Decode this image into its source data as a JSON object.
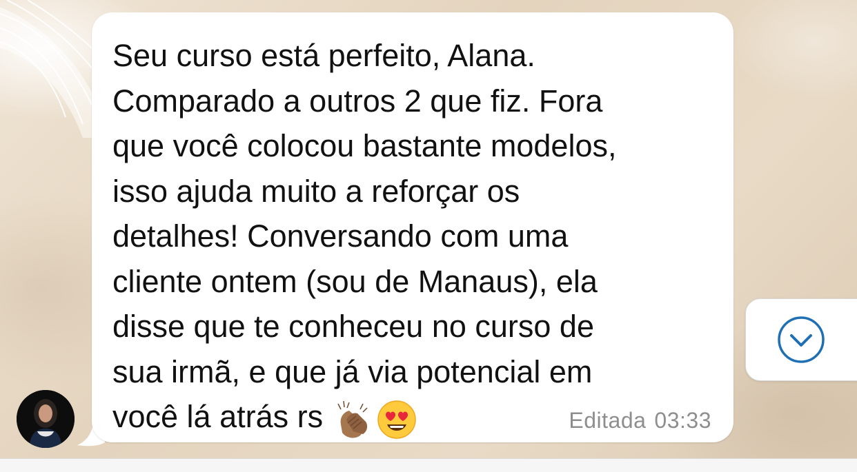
{
  "message": {
    "text": "Seu curso está perfeito, Alana.\nComparado a outros 2 que fiz. Fora\nque você colocou bastante modelos,\nisso ajuda muito a reforçar os\ndetalhes! Conversando com uma\ncliente ontem (sou de Manaus), ela\ndisse que te conheceu no curso de\nsua irmã, e que já via potencial em\nvocê lá atrás rs",
    "emojis": [
      "clapping-hands",
      "heart-eyes"
    ],
    "edited_label": "Editada",
    "time": "03:33"
  },
  "colors": {
    "bubble": "#ffffff",
    "meta_text": "#8e8e8e",
    "accent": "#1f6fb5"
  },
  "icons": {
    "scroll_down": "chevron-down-circle-icon"
  }
}
